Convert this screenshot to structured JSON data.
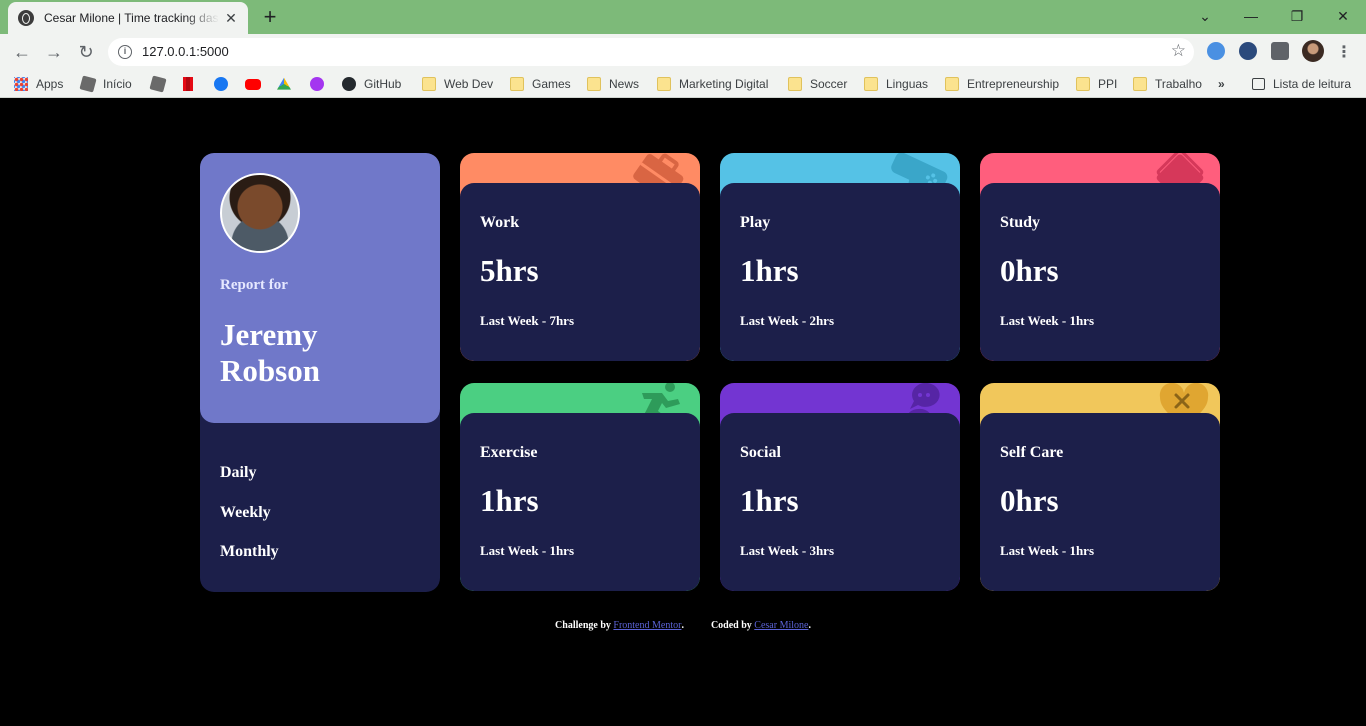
{
  "browser": {
    "tab_title": "Cesar Milone | Time tracking dashboard",
    "url": "127.0.0.1:5000",
    "bookmarks": {
      "apps": "Apps",
      "inicio": "Início",
      "github": "GitHub",
      "webdev": "Web Dev",
      "games": "Games",
      "news": "News",
      "marketing": "Marketing Digital",
      "soccer": "Soccer",
      "linguas": "Linguas",
      "entrepreneurship": "Entrepreneurship",
      "ppi": "PPI",
      "trabalho": "Trabalho",
      "more": "»",
      "reading_list": "Lista de leitura"
    }
  },
  "profile": {
    "report_label": "Report for",
    "name": "Jeremy Robson",
    "periods": [
      "Daily",
      "Weekly",
      "Monthly"
    ]
  },
  "activities": [
    {
      "title": "Work",
      "current": "5hrs",
      "previous": "Last Week - 7hrs",
      "color": "#ff8b64",
      "icon": "briefcase-icon"
    },
    {
      "title": "Play",
      "current": "1hrs",
      "previous": "Last Week - 2hrs",
      "color": "#55c2e6",
      "icon": "gamepad-icon"
    },
    {
      "title": "Study",
      "current": "0hrs",
      "previous": "Last Week - 1hrs",
      "color": "#ff5e7d",
      "icon": "book-icon"
    },
    {
      "title": "Exercise",
      "current": "1hrs",
      "previous": "Last Week - 1hrs",
      "color": "#4bcf82",
      "icon": "runner-icon"
    },
    {
      "title": "Social",
      "current": "1hrs",
      "previous": "Last Week - 3hrs",
      "color": "#7335d2",
      "icon": "chat-icon"
    },
    {
      "title": "Self Care",
      "current": "0hrs",
      "previous": "Last Week - 1hrs",
      "color": "#f1c75b",
      "icon": "heart-icon"
    }
  ],
  "footer": {
    "challenge_by": "Challenge by",
    "frontend_mentor": "Frontend Mentor",
    "coded_by": "Coded by",
    "author": "Cesar Milone",
    "period": "."
  }
}
